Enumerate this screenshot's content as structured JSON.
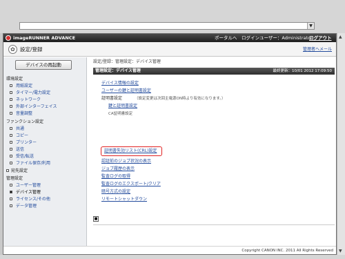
{
  "browser": {
    "address_value": ""
  },
  "titlebar": {
    "app_title": "imageRUNNER ADVANCE",
    "portal_link": "ポータルへ",
    "login_user": "ログインユーザー：Administrator",
    "logout": "ログアウト"
  },
  "subheader": {
    "heading": "設定/登録",
    "admin_link": "管理者へメール"
  },
  "sidebar": {
    "restart_button": "デバイスの再起動",
    "sections": [
      {
        "label": "環境設定"
      },
      {
        "label": "ファンクション設定"
      },
      {
        "label": "宛先設定"
      },
      {
        "label": "管理設定"
      }
    ],
    "items": [
      {
        "label": "用紙設定"
      },
      {
        "label": "タイマー/電力設定"
      },
      {
        "label": "ネットワーク"
      },
      {
        "label": "外部インターフェイス"
      },
      {
        "label": "音量調整"
      },
      {
        "label": "共通"
      },
      {
        "label": "コピー"
      },
      {
        "label": "プリンター"
      },
      {
        "label": "送信"
      },
      {
        "label": "受信/転送"
      },
      {
        "label": "ファイル保存/利用"
      },
      {
        "label": "ユーザー管理"
      },
      {
        "label": "デバイス管理"
      },
      {
        "label": "ライセンス/その他"
      },
      {
        "label": "データ管理"
      }
    ]
  },
  "main": {
    "breadcrumb": "設定/登録：管理設定：デバイス管理",
    "section_title": "管理設定：デバイス管理",
    "last_updated": "最終更新：10/01 2012 17:09:50",
    "links": {
      "device_info": "デバイス情報の設定",
      "user_cert": "ユーザーの鍵と証明書設定",
      "cert_label": "証明書設定",
      "cert_note": "（設定変更は次回主電源ON時より有効になります。）",
      "key_cert": "鍵と証明書設定",
      "ca_cert": "CA証明書設定",
      "crl": "証明書失効リスト(CRL)設定",
      "job_status": "認証前のジョブ状況の表示",
      "job_history": "ジョブ履歴の表示",
      "audit_log": "監査ログの取得",
      "audit_export": "監査ログのエクスポート/クリア",
      "encryption": "暗号方式の設定",
      "remote_shutdown": "リモートシャットダウン"
    }
  },
  "footer": {
    "copyright": "Copyright CANON INC. 2011 All Rights Reserved"
  },
  "colors": {
    "link": "#214a9c",
    "highlight": "#e02020",
    "titlebar": "#2e2e2e"
  }
}
